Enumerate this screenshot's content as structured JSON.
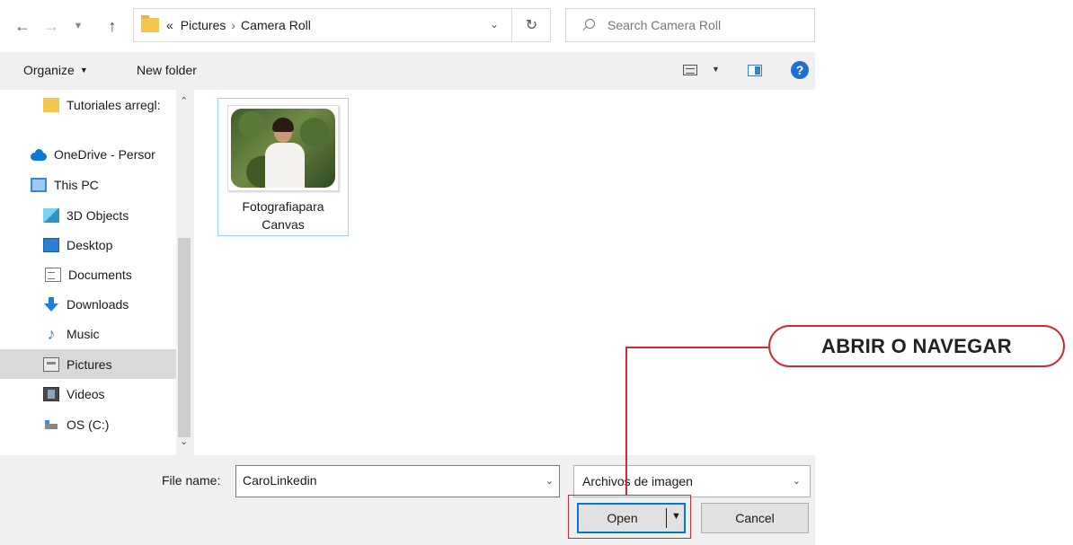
{
  "addressbar": {
    "breadcrumb_overflow": "«",
    "breadcrumb": [
      "Pictures",
      "Camera Roll"
    ],
    "separator": "›",
    "search_placeholder": "Search Camera Roll"
  },
  "toolbar": {
    "organize_label": "Organize",
    "new_folder_label": "New folder",
    "help_glyph": "?"
  },
  "navpane": {
    "items": [
      {
        "label": "Tutoriales arregl:",
        "icon": "folder-icon"
      },
      {
        "label": "OneDrive - Persor",
        "icon": "onedrive-icon"
      },
      {
        "label": "This PC",
        "icon": "this-pc-icon"
      },
      {
        "label": "3D Objects",
        "icon": "3d-objects-icon"
      },
      {
        "label": "Desktop",
        "icon": "desktop-icon"
      },
      {
        "label": "Documents",
        "icon": "documents-icon"
      },
      {
        "label": "Downloads",
        "icon": "downloads-icon"
      },
      {
        "label": "Music",
        "icon": "music-icon"
      },
      {
        "label": "Pictures",
        "icon": "pictures-icon"
      },
      {
        "label": "Videos",
        "icon": "videos-icon"
      },
      {
        "label": "OS (C:)",
        "icon": "drive-icon"
      }
    ],
    "selected": "Pictures"
  },
  "content": {
    "files": [
      {
        "name_line1": "Fotografiapara",
        "name_line2": "Canvas"
      }
    ]
  },
  "bottom": {
    "file_name_label": "File name:",
    "file_name_value": "CaroLinkedin",
    "file_type_value": "Archivos de imagen",
    "open_label": "Open",
    "cancel_label": "Cancel"
  },
  "annotation": {
    "callout_text": "ABRIR O NAVEGAR",
    "color": "#cc2a30"
  },
  "colors": {
    "accent": "#0078d7",
    "selection": "#d9d9d9",
    "tile_border": "#99d1ff"
  }
}
